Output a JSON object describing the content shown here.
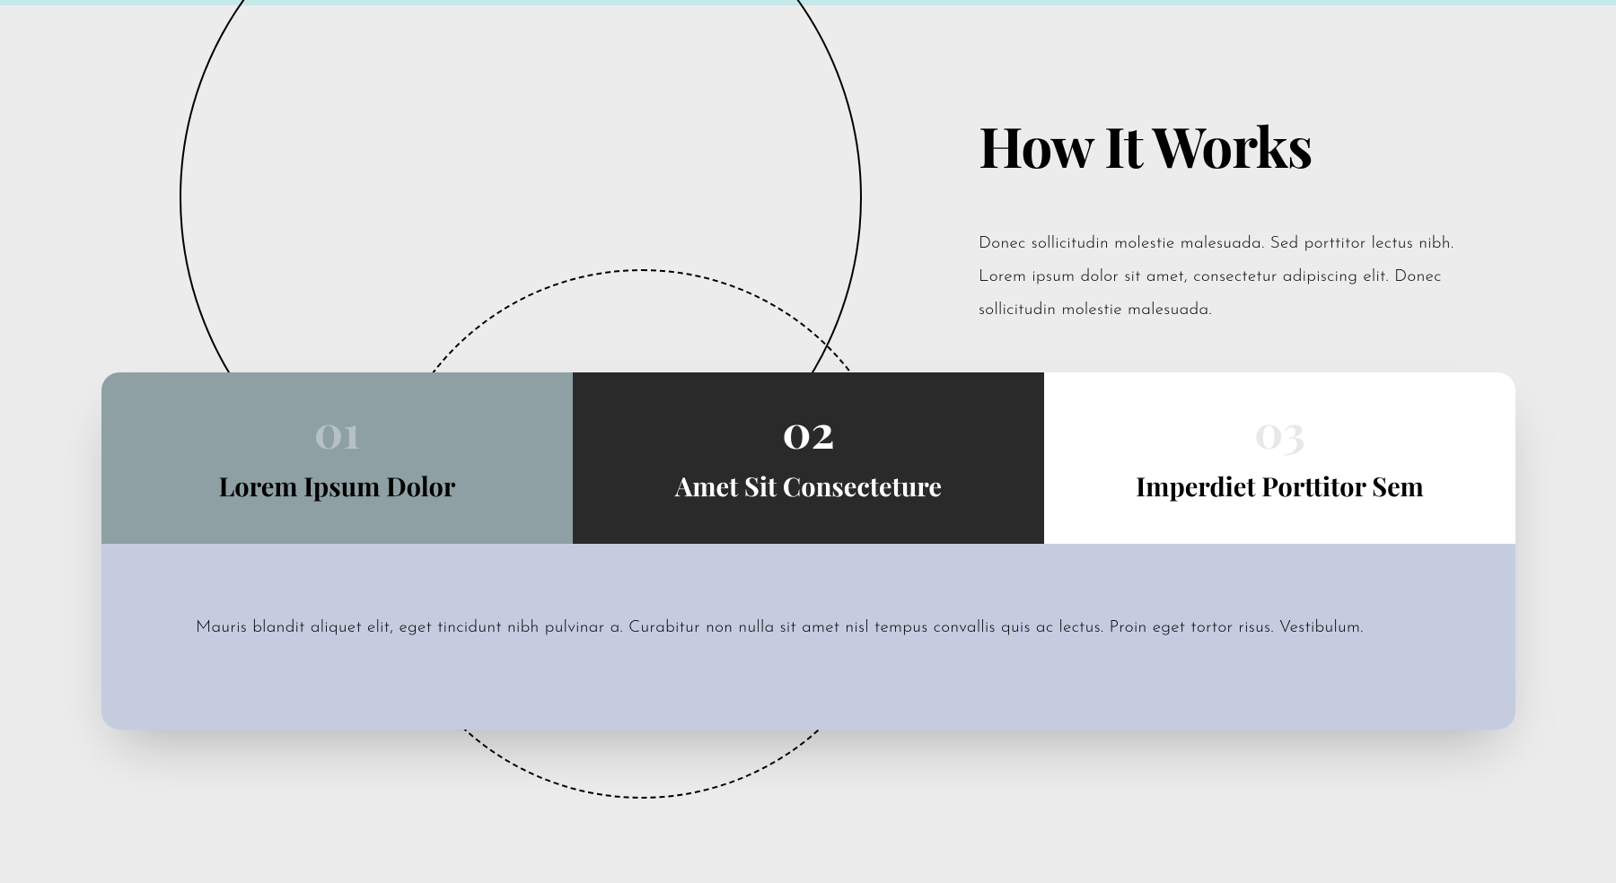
{
  "header": {
    "title": "How It Works",
    "description": "Donec sollicitudin molestie malesuada. Sed porttitor lectus nibh. Lorem ipsum dolor sit amet, consectetur adipiscing elit. Donec sollicitudin molestie malesuada."
  },
  "tabs": [
    {
      "number": "01",
      "title": "Lorem Ipsum Dolor"
    },
    {
      "number": "02",
      "title": "Amet Sit Consecteture"
    },
    {
      "number": "03",
      "title": "Imperdiet Porttitor Sem"
    }
  ],
  "content": {
    "text": "Mauris blandit aliquet elit, eget tincidunt nibh pulvinar a. Curabitur non nulla sit amet nisl tempus convallis quis ac lectus. Proin eget tortor risus. Vestibulum."
  }
}
